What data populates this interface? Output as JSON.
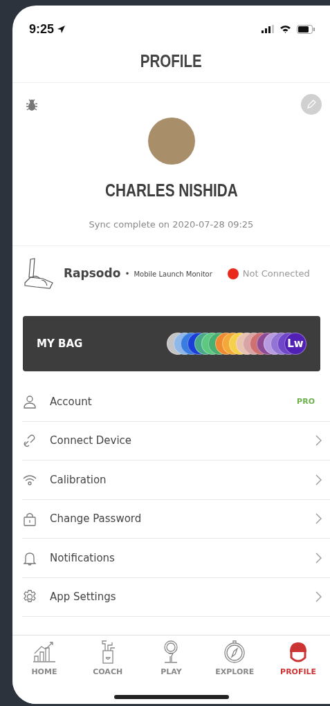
{
  "status_bar": {
    "time": "9:25"
  },
  "header": {
    "title": "PROFILE"
  },
  "profile": {
    "name": "CHARLES NISHIDA",
    "sync": "Sync complete on 2020-07-28 09:25"
  },
  "device": {
    "brand": "Rapsodo",
    "separator": "•",
    "model": "Mobile Launch Monitor",
    "status": "Not Connected",
    "connected": false
  },
  "bag": {
    "title": "MY BAG",
    "clubs": [
      {
        "color": "#c4c4c4"
      },
      {
        "color": "#8fb8e8"
      },
      {
        "color": "#3a7de0"
      },
      {
        "color": "#1a3ed8"
      },
      {
        "color": "#4aa88a"
      },
      {
        "color": "#5cc880"
      },
      {
        "color": "#48b070"
      },
      {
        "color": "#f08a30"
      },
      {
        "color": "#f4a838"
      },
      {
        "color": "#f6d048"
      },
      {
        "color": "#e8c4b0"
      },
      {
        "color": "#d8a4a4"
      },
      {
        "color": "#d07070"
      },
      {
        "color": "#8e4a94"
      },
      {
        "color": "#b89ae0"
      },
      {
        "color": "#9274d4"
      },
      {
        "color": "#7046c8"
      },
      {
        "color": "#5220b4",
        "label": "Lw"
      }
    ]
  },
  "menu": [
    {
      "kind": "person",
      "label": "Account",
      "badge": "PRO"
    },
    {
      "kind": "link",
      "label": "Connect Device"
    },
    {
      "kind": "wifi",
      "label": "Calibration"
    },
    {
      "kind": "lock",
      "label": "Change Password"
    },
    {
      "kind": "bell",
      "label": "Notifications"
    },
    {
      "kind": "gear",
      "label": "App Settings"
    }
  ],
  "tabs": [
    {
      "kind": "chart",
      "label": "HOME",
      "selected": false
    },
    {
      "kind": "bag",
      "label": "COACH",
      "selected": false
    },
    {
      "kind": "tee",
      "label": "PLAY",
      "selected": false
    },
    {
      "kind": "compass",
      "label": "EXPLORE",
      "selected": false
    },
    {
      "kind": "helmet",
      "label": "PROFILE",
      "selected": true
    }
  ]
}
